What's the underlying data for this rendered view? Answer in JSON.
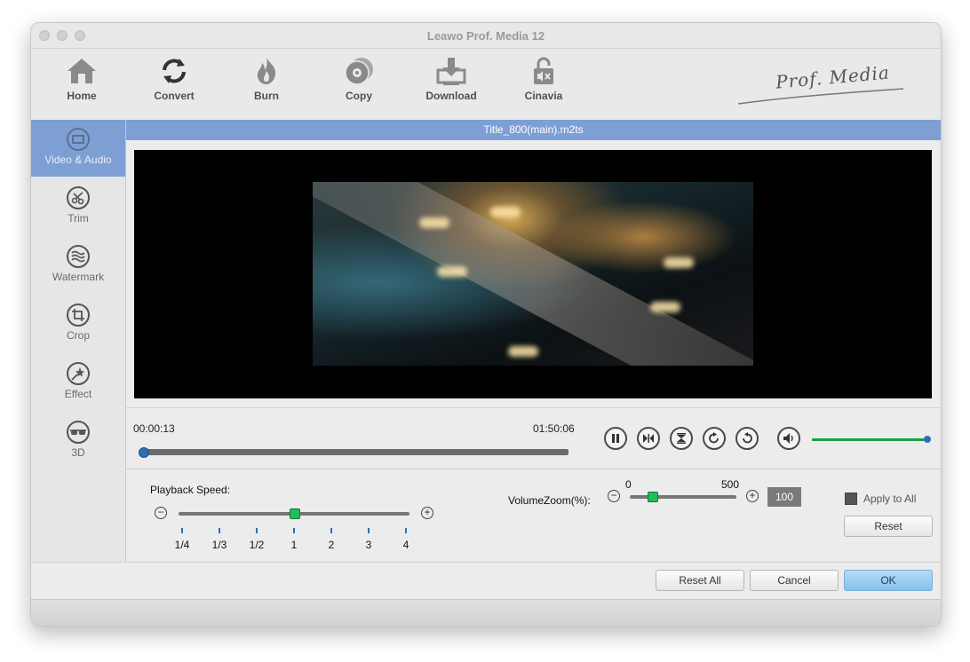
{
  "window": {
    "title": "Leawo Prof. Media 12"
  },
  "toolbar": {
    "items": [
      {
        "label": "Home",
        "icon": "home-icon"
      },
      {
        "label": "Convert",
        "icon": "convert-icon"
      },
      {
        "label": "Burn",
        "icon": "burn-icon"
      },
      {
        "label": "Copy",
        "icon": "copy-icon"
      },
      {
        "label": "Download",
        "icon": "download-icon"
      },
      {
        "label": "Cinavia",
        "icon": "cinavia-icon"
      }
    ],
    "brand": "Prof. Media"
  },
  "sidebar": {
    "items": [
      {
        "label": "Video & Audio",
        "icon": "video-audio-icon",
        "active": true
      },
      {
        "label": "Trim",
        "icon": "trim-icon",
        "active": false
      },
      {
        "label": "Watermark",
        "icon": "watermark-icon",
        "active": false
      },
      {
        "label": "Crop",
        "icon": "crop-icon",
        "active": false
      },
      {
        "label": "Effect",
        "icon": "effect-icon",
        "active": false
      },
      {
        "label": "3D",
        "icon": "3d-icon",
        "active": false
      }
    ]
  },
  "player": {
    "file_title": "Title_800(main).m2ts",
    "current_time": "00:00:13",
    "total_time": "01:50:06",
    "progress_fraction": 0.002,
    "volume_fraction": 1.0
  },
  "settings": {
    "playback_speed_label": "Playback Speed:",
    "speed_ticks": [
      "1/4",
      "1/3",
      "1/2",
      "1",
      "2",
      "3",
      "4"
    ],
    "speed_selected": "1",
    "volume_zoom_label": "VolumeZoom(%):",
    "volume_zoom_min": "0",
    "volume_zoom_max": "500",
    "volume_zoom_value": "100",
    "apply_to_all_label": "Apply to All",
    "reset_label": "Reset"
  },
  "footer": {
    "reset_all_label": "Reset All",
    "cancel_label": "Cancel",
    "ok_label": "OK"
  },
  "colors": {
    "accent_blue": "#7d9fd4",
    "volume_green": "#1aa04a",
    "knob_green": "#1fbf5a",
    "ok_button": "#86c0ec"
  }
}
